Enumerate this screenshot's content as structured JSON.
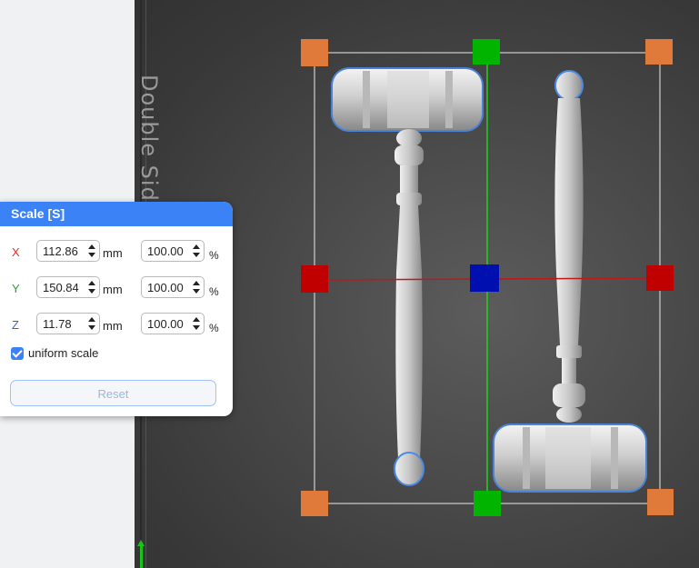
{
  "plate": {
    "label": "Double Side"
  },
  "scale_panel": {
    "title": "Scale [S]",
    "rows": [
      {
        "axis": "X",
        "size": "112.86",
        "size_unit": "mm",
        "percent": "100.00",
        "percent_unit": "%"
      },
      {
        "axis": "Y",
        "size": "150.84",
        "size_unit": "mm",
        "percent": "100.00",
        "percent_unit": "%"
      },
      {
        "axis": "Z",
        "size": "11.78",
        "size_unit": "mm",
        "percent": "100.00",
        "percent_unit": "%"
      }
    ],
    "uniform_scale": {
      "label": "uniform scale",
      "checked": true
    },
    "reset_label": "Reset"
  },
  "colors": {
    "accent": "#3b82f6",
    "axis_x": "#e03030",
    "axis_y": "#2aa52a",
    "axis_z": "#3b5fd0",
    "corner_handle": "#e07a3a",
    "x_handle": "#c00000",
    "y_handle": "#00b400",
    "center_handle": "#0010b0"
  },
  "icons": {
    "checkbox": "check-icon",
    "spinner": "spin-arrows-icon",
    "axis_indicator": "arrow-up-icon"
  }
}
